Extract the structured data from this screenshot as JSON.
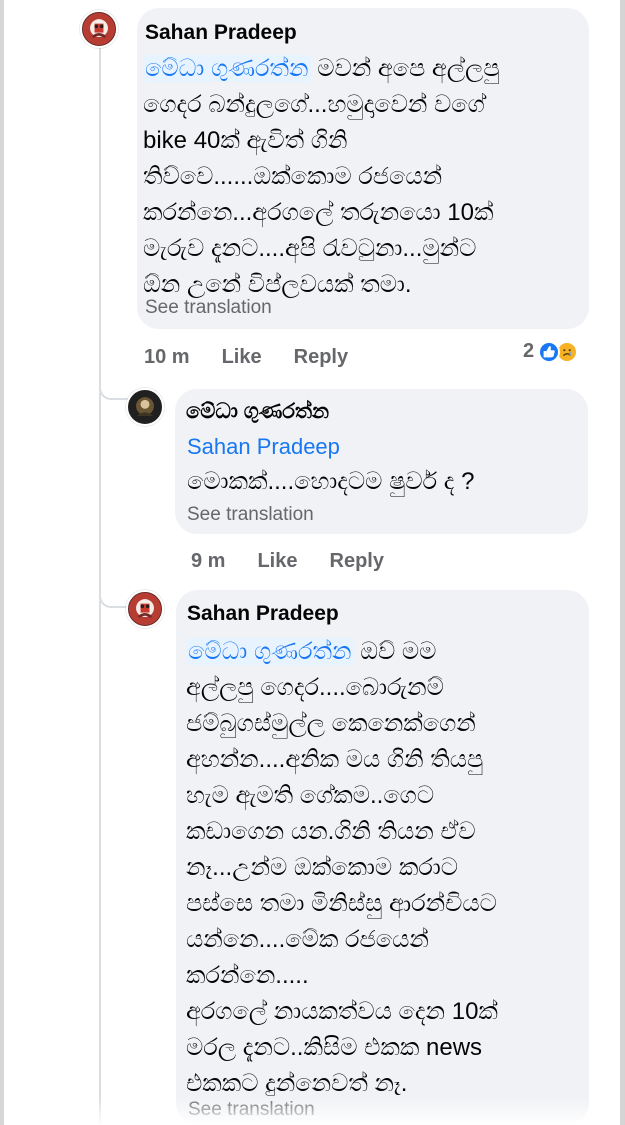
{
  "comments": [
    {
      "author": "Sahan Pradeep",
      "mention": "මේධා ගුණරත්න",
      "lines": [
        "මවන් අපෙ අල්ලපු",
        "ගෙදර බන්දුලගේ...හමුදාවෙන් වගේ",
        "bike 40ක් ඇවිත් ගිනි",
        "තිව්වෙ......ඔක්කොම රජයෙන්",
        "කරන්නෙ...අරගලේ තරුනයො 10ක්",
        "මැරුව දැනට....අපි රැවටුනා...මුන්ට",
        "ඕන උනේ විප්ලවයක් තමා."
      ],
      "see_translation": "See translation",
      "meta": {
        "time": "10 m",
        "like": "Like",
        "reply": "Reply"
      },
      "reaction_count": "2",
      "reaction_icons": [
        "like-reaction-icon",
        "sad-reaction-icon"
      ]
    },
    {
      "author": "මේධා ගුණරත්න",
      "mention": "Sahan Pradeep",
      "lines": [
        "මොකක්....හොදටම ෂුවර් ද ?"
      ],
      "see_translation": "See translation",
      "meta": {
        "time": "9 m",
        "like": "Like",
        "reply": "Reply"
      }
    },
    {
      "author": "Sahan Pradeep",
      "mention": "මේධා ගුණරත්න",
      "lines": [
        "ඔව් මම",
        "අල්ලපු ගෙදර....බොරුනම්",
        "ජම්බුගස්මුල්ල කෙනෙක්ගෙන්",
        "අහන්න....අනික මය ගිනි තියපු",
        "හැම ඇමති ගේකම..ගෙට",
        "කඩාගෙන යන.ගිනි තියන ඒව",
        "නෑ...උන්ම ඔක්කොම කරාට",
        "පස්සෙ තමා මිනිස්සු ආරන්චියට",
        "යන්නෙ....මේක රජයෙන්",
        "කරන්නෙ.....",
        "අරගලේ නායකත්වය දෙන 10ක්",
        "මරල දැනට..කිසිම එකක news",
        "එකකට දුන්නෙවත් නෑ."
      ],
      "see_translation": "See translation"
    }
  ],
  "colors": {
    "link": "#1877f2",
    "mention_bg": "#e7f3ff",
    "bubble_bg": "#f0f2f5",
    "muted_text": "#65676b",
    "thread_line": "#dadde1"
  }
}
